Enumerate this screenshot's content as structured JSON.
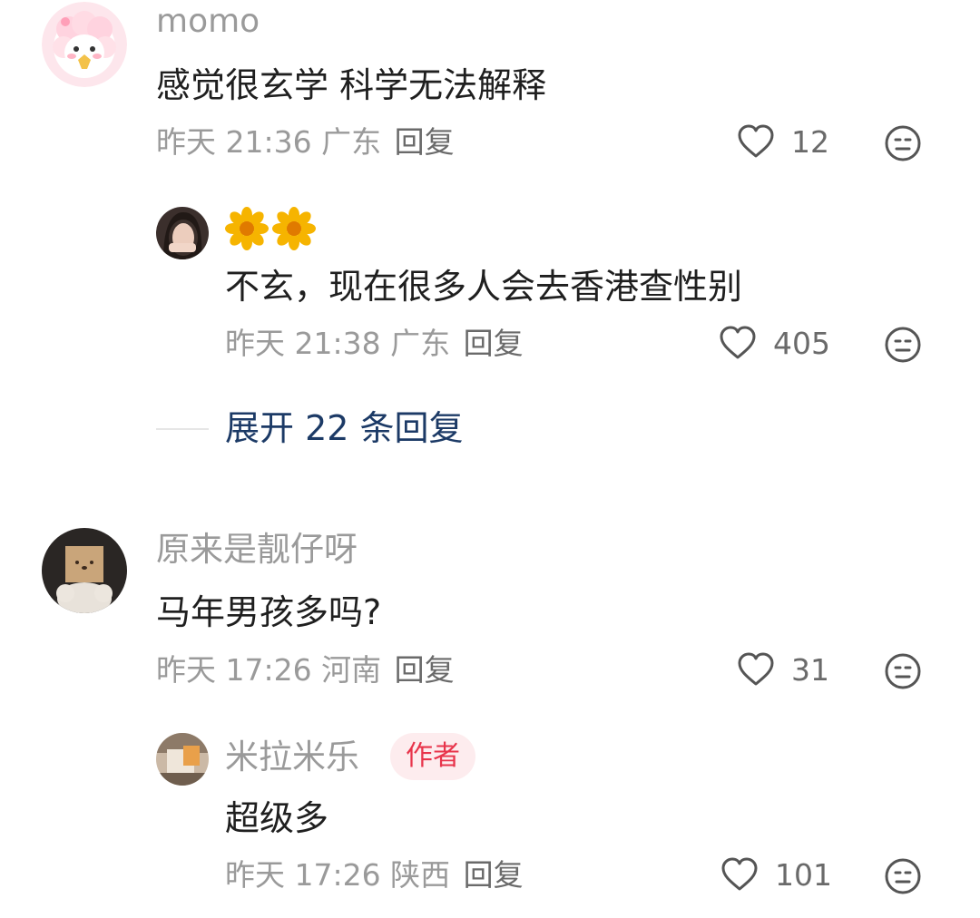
{
  "comments": [
    {
      "username": "momo",
      "content": "感觉很玄学 科学无法解释",
      "time": "昨天 21:36",
      "location": "广东",
      "reply_label": "回复",
      "likes": "12",
      "replies": [
        {
          "username_emoji": "🌼🌼",
          "content": "不玄，现在很多人会去香港查性别",
          "time": "昨天 21:38",
          "location": "广东",
          "reply_label": "回复",
          "likes": "405"
        }
      ],
      "expand_label": "展开 22 条回复"
    },
    {
      "username": "原来是靓仔呀",
      "content": "马年男孩多吗?",
      "time": "昨天 17:26",
      "location": "河南",
      "reply_label": "回复",
      "likes": "31",
      "replies": [
        {
          "username": "米拉米乐",
          "badge": "作者",
          "content": "超级多",
          "time": "昨天 17:26",
          "location": "陕西",
          "reply_label": "回复",
          "likes": "101"
        }
      ]
    }
  ],
  "colors": {
    "username": "#9a9a9a",
    "content": "#1f1f1f",
    "meta": "#9a9a9a",
    "expand": "#1c3a66",
    "badge_text": "#e8344b",
    "badge_bg": "#fdecee"
  },
  "icons": [
    "heart-outline-icon",
    "neutral-face-icon",
    "sunflower-emoji"
  ]
}
